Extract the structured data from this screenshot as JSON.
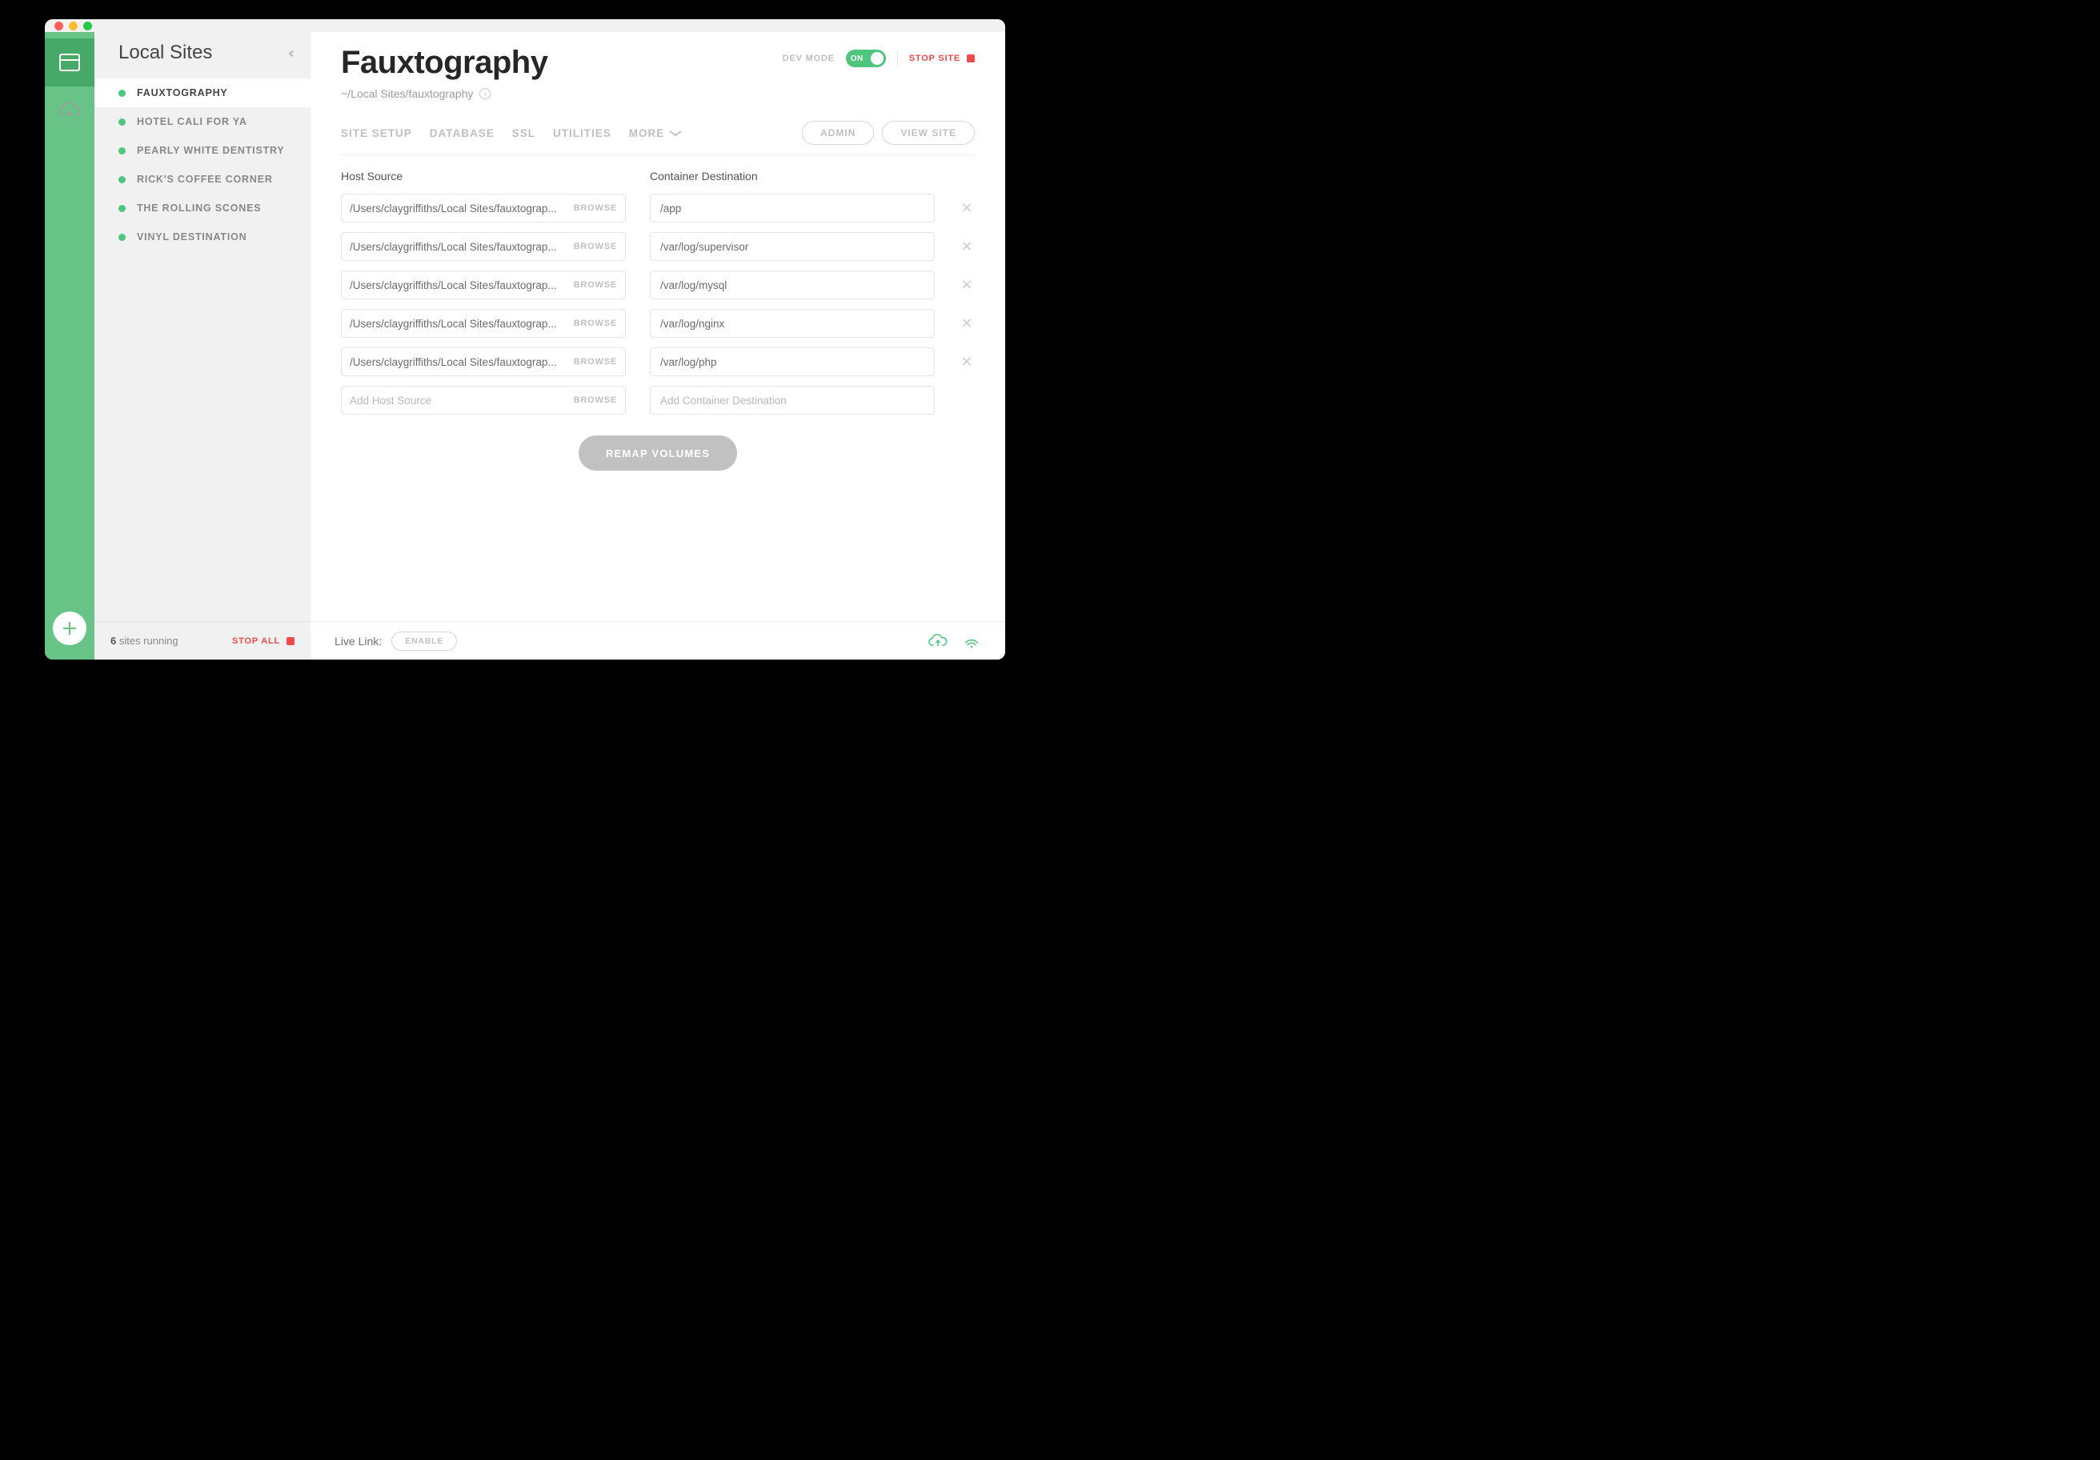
{
  "sidebar": {
    "title": "Local Sites",
    "items": [
      {
        "name": "FAUXTOGRAPHY",
        "active": true
      },
      {
        "name": "HOTEL CALI FOR YA",
        "active": false
      },
      {
        "name": "PEARLY WHITE DENTISTRY",
        "active": false
      },
      {
        "name": "RICK'S COFFEE CORNER",
        "active": false
      },
      {
        "name": "THE ROLLING SCONES",
        "active": false
      },
      {
        "name": "VINYL DESTINATION",
        "active": false
      }
    ],
    "footer": {
      "count": "6",
      "count_label": "sites running",
      "stop_all": "STOP ALL"
    }
  },
  "header": {
    "site_title": "Fauxtography",
    "path": "~/Local Sites/fauxtography",
    "devmode_label": "DEV MODE",
    "toggle_label": "ON",
    "stop_site": "STOP SITE",
    "tabs": [
      "SITE SETUP",
      "DATABASE",
      "SSL",
      "UTILITIES",
      "MORE"
    ],
    "admin_btn": "ADMIN",
    "view_btn": "VIEW SITE"
  },
  "volumes": {
    "host_header": "Host Source",
    "dest_header": "Container Destination",
    "browse_label": "BROWSE",
    "rows": [
      {
        "host": "/Users/claygriffiths/Local Sites/fauxtograp...",
        "dest": "/app"
      },
      {
        "host": "/Users/claygriffiths/Local Sites/fauxtograp...",
        "dest": "/var/log/supervisor"
      },
      {
        "host": "/Users/claygriffiths/Local Sites/fauxtograp...",
        "dest": "/var/log/mysql"
      },
      {
        "host": "/Users/claygriffiths/Local Sites/fauxtograp...",
        "dest": "/var/log/nginx"
      },
      {
        "host": "/Users/claygriffiths/Local Sites/fauxtograp...",
        "dest": "/var/log/php"
      }
    ],
    "host_placeholder": "Add Host Source",
    "dest_placeholder": "Add Container Destination",
    "remap_btn": "REMAP VOLUMES"
  },
  "footer": {
    "livelink_label": "Live Link:",
    "enable_btn": "ENABLE"
  }
}
